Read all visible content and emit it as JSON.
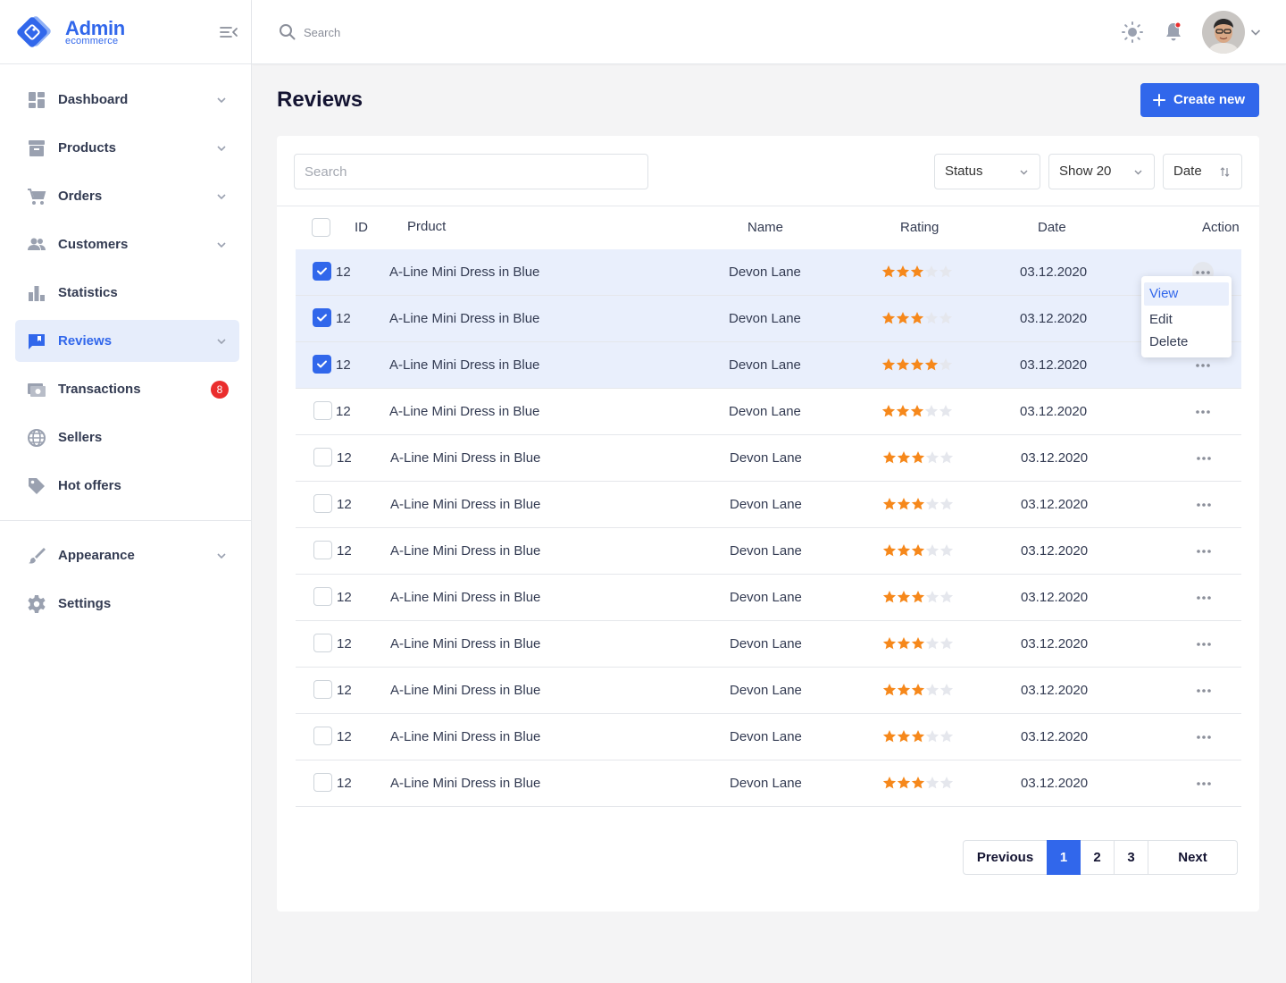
{
  "brand": {
    "title": "Admin",
    "subtitle": "ecommerce"
  },
  "header": {
    "search_placeholder": "Search"
  },
  "sidebar": {
    "items": [
      {
        "label": "Dashboard",
        "icon": "dashboard-icon",
        "chevron": true
      },
      {
        "label": "Products",
        "icon": "archive-box-icon",
        "chevron": true
      },
      {
        "label": "Orders",
        "icon": "cart-icon",
        "chevron": true
      },
      {
        "label": "Customers",
        "icon": "people-icon",
        "chevron": true
      },
      {
        "label": "Statistics",
        "icon": "bar-chart-icon",
        "chevron": false
      },
      {
        "label": "Reviews",
        "icon": "comment-icon",
        "chevron": true,
        "active": true
      },
      {
        "label": "Transactions",
        "icon": "money-icon",
        "chevron": false,
        "badge": "8"
      },
      {
        "label": "Sellers",
        "icon": "globe-icon",
        "chevron": false
      },
      {
        "label": "Hot offers",
        "icon": "tag-icon",
        "chevron": false
      }
    ],
    "secondary": [
      {
        "label": "Appearance",
        "icon": "brush-icon",
        "chevron": true
      },
      {
        "label": "Settings",
        "icon": "gear-icon",
        "chevron": false
      }
    ]
  },
  "page": {
    "title": "Reviews",
    "create_label": "Create new"
  },
  "filters": {
    "search_placeholder": "Search",
    "status": "Status",
    "show": "Show 20",
    "date": "Date"
  },
  "table": {
    "headers": {
      "id": "ID",
      "product": "Prduct",
      "name": "Name",
      "rating": "Rating",
      "date": "Date",
      "action": "Action"
    },
    "rows": [
      {
        "id": "12",
        "product": "A-Line Mini Dress in Blue",
        "name": "Devon Lane",
        "rating": 3,
        "date": "03.12.2020",
        "selected": true
      },
      {
        "id": "12",
        "product": "A-Line Mini Dress in Blue",
        "name": "Devon Lane",
        "rating": 3,
        "date": "03.12.2020",
        "selected": true
      },
      {
        "id": "12",
        "product": "A-Line Mini Dress in Blue",
        "name": "Devon Lane",
        "rating": 4,
        "date": "03.12.2020",
        "selected": true
      },
      {
        "id": "12",
        "product": "A-Line Mini Dress in Blue",
        "name": "Devon Lane",
        "rating": 3,
        "date": "03.12.2020",
        "selected": false
      },
      {
        "id": "12",
        "product": "A-Line Mini Dress in Blue",
        "name": "Devon Lane",
        "rating": 3,
        "date": "03.12.2020",
        "selected": false
      },
      {
        "id": "12",
        "product": "A-Line Mini Dress in Blue",
        "name": "Devon Lane",
        "rating": 3,
        "date": "03.12.2020",
        "selected": false
      },
      {
        "id": "12",
        "product": "A-Line Mini Dress in Blue",
        "name": "Devon Lane",
        "rating": 3,
        "date": "03.12.2020",
        "selected": false
      },
      {
        "id": "12",
        "product": "A-Line Mini Dress in Blue",
        "name": "Devon Lane",
        "rating": 3,
        "date": "03.12.2020",
        "selected": false
      },
      {
        "id": "12",
        "product": "A-Line Mini Dress in Blue",
        "name": "Devon Lane",
        "rating": 3,
        "date": "03.12.2020",
        "selected": false
      },
      {
        "id": "12",
        "product": "A-Line Mini Dress in Blue",
        "name": "Devon Lane",
        "rating": 3,
        "date": "03.12.2020",
        "selected": false
      },
      {
        "id": "12",
        "product": "A-Line Mini Dress in Blue",
        "name": "Devon Lane",
        "rating": 3,
        "date": "03.12.2020",
        "selected": false
      },
      {
        "id": "12",
        "product": "A-Line Mini Dress in Blue",
        "name": "Devon Lane",
        "rating": 3,
        "date": "03.12.2020",
        "selected": false
      }
    ],
    "rating_max": 5
  },
  "action_menu": {
    "items": [
      "View",
      "Edit",
      "Delete"
    ]
  },
  "pagination": {
    "previous": "Previous",
    "pages": [
      "1",
      "2",
      "3"
    ],
    "current": "1",
    "next": "Next"
  },
  "colors": {
    "accent": "#3167eb",
    "star": "#f6881b",
    "star_empty": "#e5e7ed",
    "badge": "#ea2d2d",
    "selected_row": "#e9effc"
  }
}
